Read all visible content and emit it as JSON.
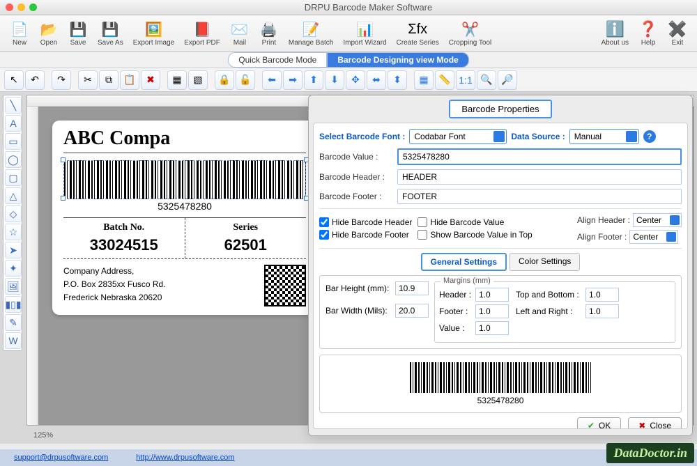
{
  "app": {
    "title": "DRPU Barcode Maker Software"
  },
  "toolbar": [
    {
      "name": "new",
      "label": "New",
      "icon": "📄"
    },
    {
      "name": "open",
      "label": "Open",
      "icon": "📂"
    },
    {
      "name": "save",
      "label": "Save",
      "icon": "💾"
    },
    {
      "name": "saveas",
      "label": "Save As",
      "icon": "💾"
    },
    {
      "name": "exportimg",
      "label": "Export Image",
      "icon": "🖼️"
    },
    {
      "name": "exportpdf",
      "label": "Export PDF",
      "icon": "📕"
    },
    {
      "name": "mail",
      "label": "Mail",
      "icon": "✉️"
    },
    {
      "name": "print",
      "label": "Print",
      "icon": "🖨️"
    },
    {
      "name": "managebatch",
      "label": "Manage Batch",
      "icon": "📝"
    },
    {
      "name": "importwiz",
      "label": "Import Wizard",
      "icon": "📊"
    },
    {
      "name": "createseries",
      "label": "Create Series",
      "icon": "Σfx"
    },
    {
      "name": "crop",
      "label": "Cropping Tool",
      "icon": "✂️"
    }
  ],
  "toolbar_right": [
    {
      "name": "about",
      "label": "About us",
      "icon": "ℹ️"
    },
    {
      "name": "help",
      "label": "Help",
      "icon": "❓"
    },
    {
      "name": "exit",
      "label": "Exit",
      "icon": "✖️"
    }
  ],
  "modes": {
    "quick": "Quick Barcode Mode",
    "design": "Barcode Designing view Mode"
  },
  "label": {
    "company": "ABC Compa",
    "barcode_value": "5325478280",
    "batch_label": "Batch No.",
    "batch_value": "33024515",
    "series_label": "Series",
    "series_value": "62501",
    "addr_title": "Company Address,",
    "addr_line1": "P.O. Box 2835xx Fusco Rd.",
    "addr_line2": "Frederick Nebraska 20620"
  },
  "zoom": "125%",
  "footer": {
    "support": "support@drpusoftware.com",
    "url": "http://www.drpusoftware.com"
  },
  "panel": {
    "title": "Barcode Properties",
    "font_label": "Select Barcode Font :",
    "font_value": "Codabar Font",
    "datasource_label": "Data Source :",
    "datasource_value": "Manual",
    "bvalue_label": "Barcode Value :",
    "bvalue": "5325478280",
    "bheader_label": "Barcode Header :",
    "bheader": "HEADER",
    "bfooter_label": "Barcode Footer :",
    "bfooter": "FOOTER",
    "hide_header": "Hide Barcode Header",
    "hide_value": "Hide Barcode Value",
    "hide_footer": "Hide Barcode Footer",
    "show_top": "Show Barcode Value in Top",
    "align_header_label": "Align Header :",
    "align_header": "Center",
    "align_footer_label": "Align Footer :",
    "align_footer": "Center",
    "tab_general": "General Settings",
    "tab_color": "Color Settings",
    "bar_height_label": "Bar Height (mm):",
    "bar_height": "10.9",
    "bar_width_label": "Bar Width (Mils):",
    "bar_width": "20.0",
    "margins_title": "Margins (mm)",
    "m_header_label": "Header :",
    "m_header": "1.0",
    "m_footer_label": "Footer :",
    "m_footer": "1.0",
    "m_value_label": "Value :",
    "m_value": "1.0",
    "m_tb_label": "Top and Bottom :",
    "m_tb": "1.0",
    "m_lr_label": "Left and Right :",
    "m_lr": "1.0",
    "preview_value": "5325478280",
    "ok": "OK",
    "close": "Close"
  },
  "watermark": "DataDoctor.in"
}
